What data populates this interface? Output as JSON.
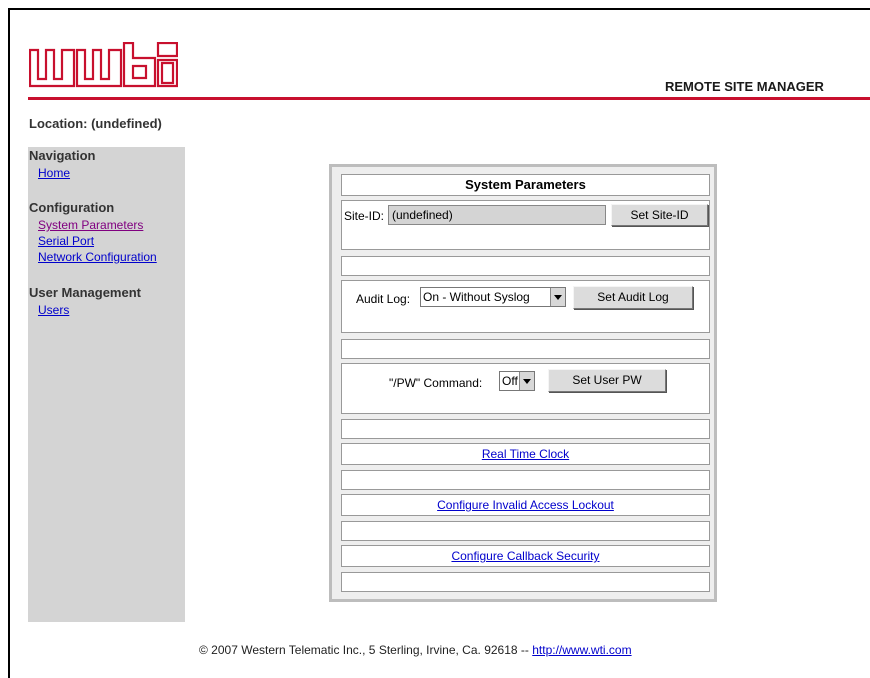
{
  "header": {
    "logo_text": "wti",
    "product_title": "REMOTE SITE MANAGER"
  },
  "location": {
    "text": "Location: (undefined)"
  },
  "sidebar": {
    "sections": [
      {
        "heading": "Navigation",
        "items": [
          {
            "label": "Home"
          }
        ]
      },
      {
        "heading": "Configuration",
        "items": [
          {
            "label": "System Parameters"
          },
          {
            "label": "Serial Port"
          },
          {
            "label": "Network Configuration"
          }
        ]
      },
      {
        "heading": "User Management",
        "items": [
          {
            "label": "Users"
          }
        ]
      }
    ]
  },
  "panel": {
    "title": "System Parameters",
    "site_id": {
      "label": "Site-ID:",
      "value": "(undefined)",
      "button": "Set Site-ID"
    },
    "audit_log": {
      "label": "Audit Log:",
      "selected": "On - Without Syslog",
      "button": "Set Audit Log"
    },
    "pw_command": {
      "label": "\"/PW\" Command:",
      "selected": "Off",
      "button": "Set User PW"
    },
    "links": {
      "real_time_clock": "Real Time Clock",
      "invalid_access_lockout": "Configure Invalid Access Lockout",
      "callback_security": "Configure Callback Security"
    }
  },
  "footer": {
    "text": "© 2007 Western Telematic Inc., 5 Sterling, Irvine, Ca. 92618 -- ",
    "link": "http://www.wti.com"
  },
  "colors": {
    "brand_red": "#c8102e",
    "sidebar_bg": "#d4d4d4",
    "link_blue": "#0000cc",
    "visited_purple": "#800080"
  }
}
